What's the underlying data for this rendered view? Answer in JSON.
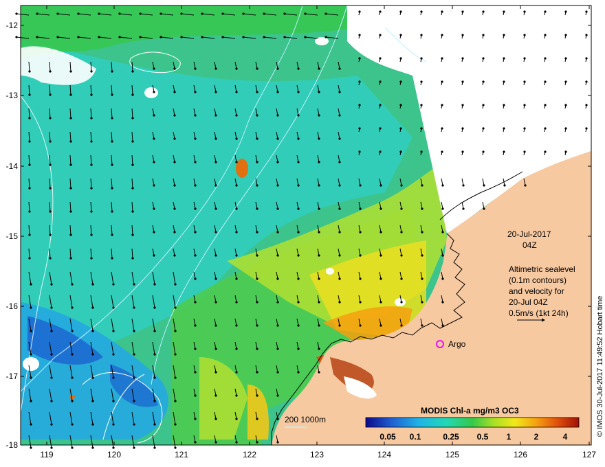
{
  "map": {
    "x_ticks": [
      "119",
      "120",
      "121",
      "122",
      "123",
      "124",
      "125",
      "126",
      "127"
    ],
    "y_ticks": [
      "-12",
      "-13",
      "-14",
      "-15",
      "-16",
      "-17",
      "-18"
    ]
  },
  "annotations": {
    "date": "20-Jul-2017",
    "time": "04Z",
    "sealevel_lines": [
      "Altimetric sealevel",
      "(0.1m contours)",
      "and velocity for",
      "20-Jul 04Z",
      "0.5m/s (1kt 24h)"
    ],
    "argo_label": "Argo",
    "depth_contour_label": "200  1000m"
  },
  "legend": {
    "title": "MODIS Chl-a mg/m3 OC3",
    "ticks": [
      "0.05",
      "0.1",
      "0.25",
      "0.5",
      "1",
      "2",
      "4"
    ],
    "colors": [
      "#0a0a8c",
      "#1e5fd2",
      "#1fb4e6",
      "#22d8b4",
      "#35c84a",
      "#a8e024",
      "#f2e81a",
      "#f5a00f",
      "#e0500a",
      "#a01008"
    ]
  },
  "credit": "© IMOS 30-Jul-2017 11:49:52 Hobart time",
  "colors": {
    "land": "#f7c9a1",
    "ocean_base": "#3cc48c",
    "argo_marker": "#ee11ee",
    "contour": "#bfefff"
  }
}
